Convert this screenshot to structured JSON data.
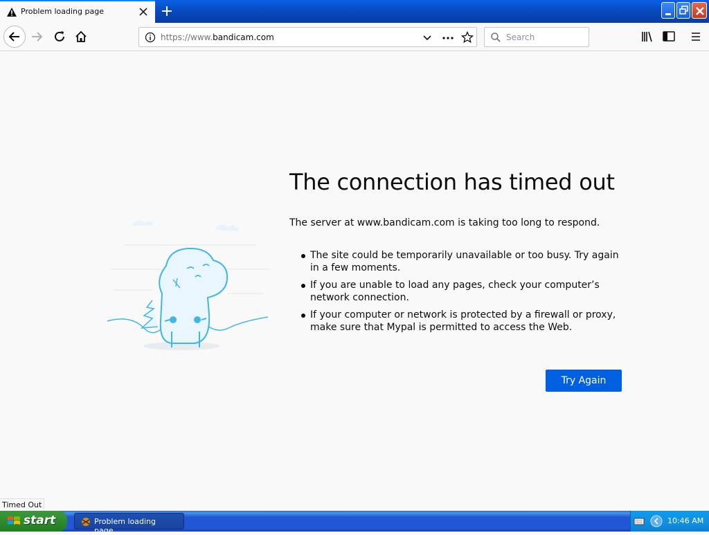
{
  "tab": {
    "title": "Problem loading page"
  },
  "urlbar": {
    "url_prefix": "https://www.",
    "url_domain": "bandicam.com"
  },
  "searchbar": {
    "placeholder": "Search"
  },
  "error": {
    "heading": "The connection has timed out",
    "description": "The server at www.bandicam.com is taking too long to respond.",
    "reasons": [
      "The site could be temporarily unavailable or too busy. Try again in a few moments.",
      "If you are unable to load any pages, check your computer’s network connection.",
      "If your computer or network is protected by a firewall or proxy, make sure that Mypal is permitted to access the Web."
    ],
    "button_label": "Try Again"
  },
  "status_text": "Timed Out",
  "taskbar": {
    "start_label": "start",
    "task_label": "Problem loading page...",
    "clock": "10:46 AM"
  },
  "colors": {
    "accent": "#0060df",
    "titlebar": "#0847b8",
    "taskbar": "#2157d7",
    "start": "#2f8a2f"
  }
}
